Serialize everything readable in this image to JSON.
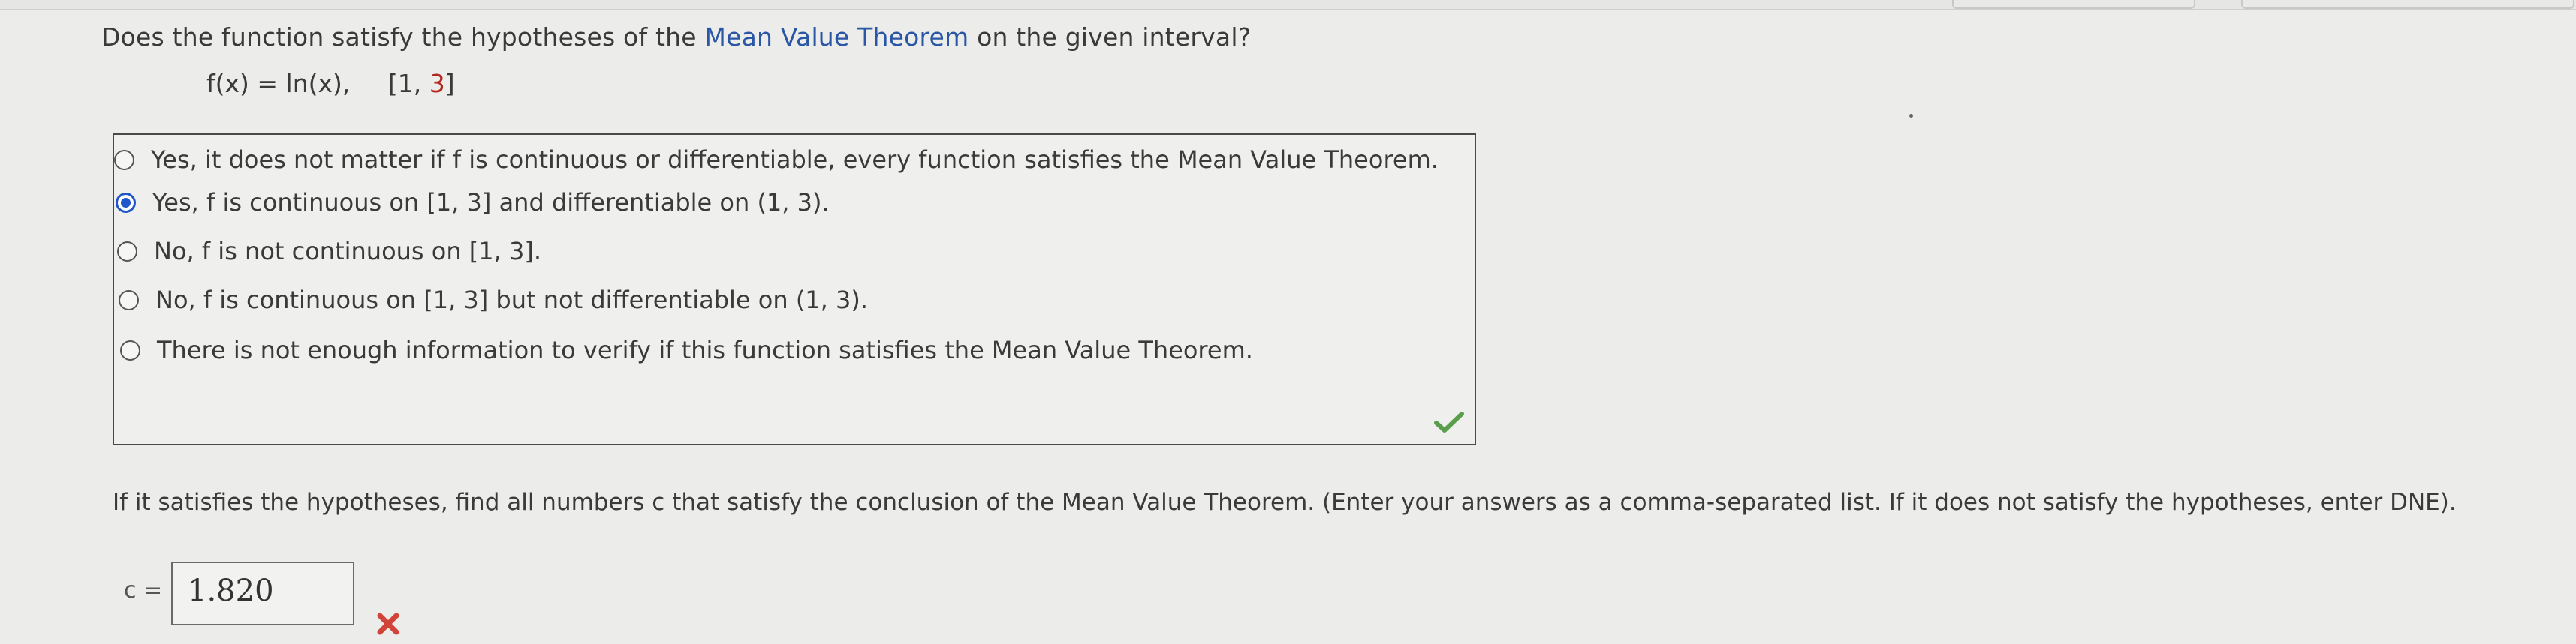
{
  "question": {
    "prefix": "Does the function satisfy the hypotheses of the ",
    "link": "Mean Value Theorem",
    "suffix": " on the given interval?"
  },
  "function": {
    "expr": "f(x) = ln(x),",
    "interval_open": "[1, ",
    "interval_end": "3",
    "interval_close": "]"
  },
  "choices": [
    {
      "label": "Yes, it does not matter if f is continuous or differentiable, every function satisfies the Mean Value Theorem.",
      "selected": false
    },
    {
      "label": "Yes, f is continuous on [1, 3] and differentiable on (1, 3).",
      "selected": true
    },
    {
      "label": "No, f is not continuous on [1, 3].",
      "selected": false
    },
    {
      "label": "No, f is continuous on [1, 3] but not differentiable on (1, 3).",
      "selected": false
    },
    {
      "label": "There is not enough information to verify if this function satisfies the Mean Value Theorem.",
      "selected": false
    }
  ],
  "part2": {
    "text": "If it satisfies the hypotheses, find all numbers c that satisfy the conclusion of the Mean Value Theorem. (Enter your answers as a comma-separated list. If it does not satisfy the hypotheses, enter DNE)."
  },
  "answer": {
    "label": "c =",
    "value": "1.820"
  },
  "colors": {
    "link": "#2a56a6",
    "radio_selected": "#1f56c9",
    "correct": "#5a9e4b",
    "incorrect": "#d0443a"
  },
  "icons": [
    "check-icon",
    "x-icon"
  ]
}
